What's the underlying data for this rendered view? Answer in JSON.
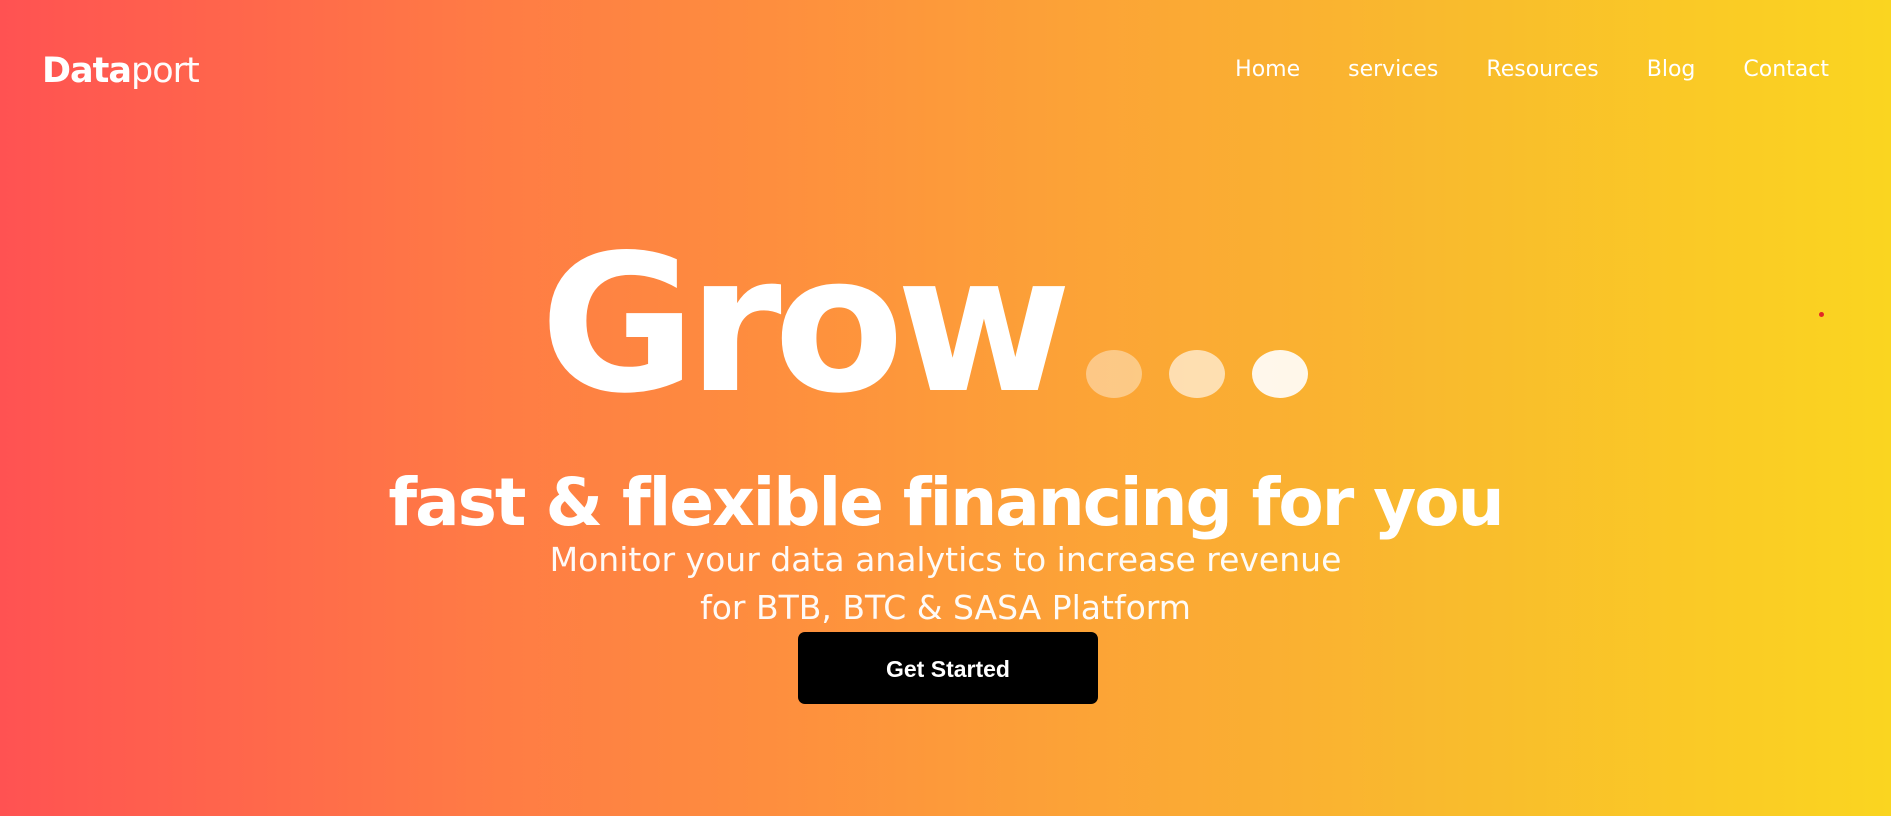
{
  "logo": {
    "bold": "Data",
    "light": "port"
  },
  "nav": {
    "items": [
      {
        "label": "Home"
      },
      {
        "label": "services"
      },
      {
        "label": "Resources"
      },
      {
        "label": "Blog"
      },
      {
        "label": "Contact"
      }
    ]
  },
  "hero": {
    "title": "Grow",
    "headline": "fast & flexible financing for you",
    "subtext_line1": "Monitor your data analytics to increase revenue",
    "subtext_line2": "for BTB, BTC & SASA Platform",
    "cta_label": "Get Started"
  },
  "colors": {
    "gradient_start": "#ff5252",
    "gradient_mid": "#fd9a3a",
    "gradient_end": "#fad520",
    "button_bg": "#000000",
    "text": "#ffffff",
    "accent_dot": "#e32626"
  }
}
